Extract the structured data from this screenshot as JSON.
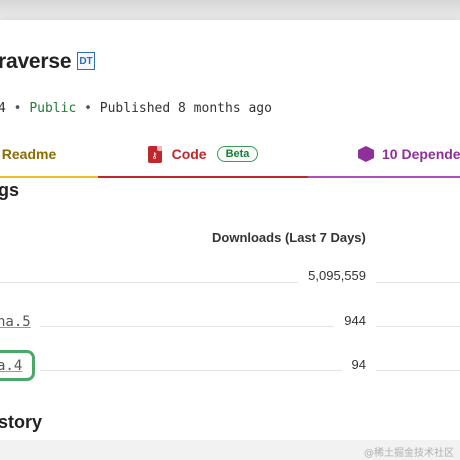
{
  "package": {
    "title": "raverse",
    "badge": "DT",
    "version_fragment": "4",
    "visibility": "Public",
    "published": "Published 8 months ago"
  },
  "tabs": [
    {
      "label": "Readme"
    },
    {
      "label": "Code",
      "badge": "Beta"
    },
    {
      "label": "10 Dependen"
    }
  ],
  "tags_section": {
    "title": "gs",
    "column_header": "Downloads (Last 7 Days)",
    "rows": [
      {
        "version": "",
        "downloads": "5,095,559"
      },
      {
        "version": "ha.5",
        "downloads": "944"
      },
      {
        "version": "a.4",
        "downloads": "94"
      }
    ]
  },
  "history_section": {
    "title": "story"
  },
  "watermark": "@稀土掘金技术社区"
}
